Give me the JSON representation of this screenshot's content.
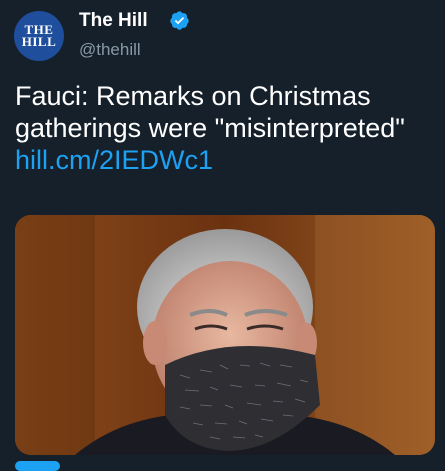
{
  "header": {
    "avatar_icon": "the-hill-logo-icon",
    "avatar_logo_text": "THE\nHILL",
    "display_name": "The Hill",
    "verified_icon": "verified-badge-icon",
    "handle": "@thehill"
  },
  "tweet": {
    "text_line1": "Fauci: Remarks on Christmas",
    "text_line2": "gatherings were \"misinterpreted\"",
    "link": "hill.cm/2IEDWc1"
  },
  "media": {
    "icon": "photo-of-man-wearing-face-mask"
  },
  "colors": {
    "background": "#15202b",
    "text": "#ffffff",
    "secondary_text": "#8899a6",
    "link": "#1da1f2",
    "verified": "#1da1f2",
    "avatar_bg": "#1f4f9c"
  }
}
